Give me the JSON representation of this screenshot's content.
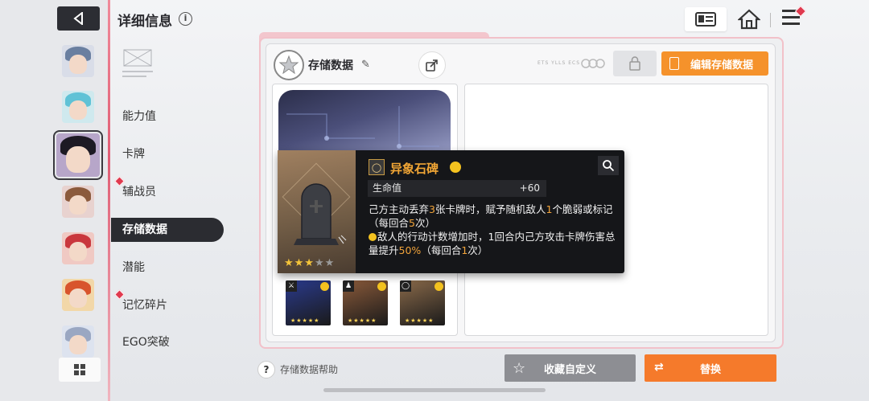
{
  "header": {
    "title": "详细信息",
    "info_glyph": "i"
  },
  "sidebar": {
    "avatars": [
      {
        "name": "avatar-1",
        "hair": "#6a7fa0",
        "bg": "#d9dde8"
      },
      {
        "name": "avatar-2",
        "hair": "#5fc2d6",
        "bg": "#cfe9ee"
      },
      {
        "name": "avatar-3",
        "hair": "#1d1a24",
        "bg": "#b7a6c9"
      },
      {
        "name": "avatar-4",
        "hair": "#8b5a3c",
        "bg": "#e8d2cf"
      },
      {
        "name": "avatar-5",
        "hair": "#c9373d",
        "bg": "#f0c9c3"
      },
      {
        "name": "avatar-6",
        "hair": "#d8542c",
        "bg": "#f2d7a8"
      },
      {
        "name": "avatar-7",
        "hair": "#9aa7c2",
        "bg": "#dde3ef"
      }
    ]
  },
  "nav": {
    "items": [
      {
        "label": "能力值",
        "badge": false
      },
      {
        "label": "卡牌",
        "badge": false
      },
      {
        "label": "辅战员",
        "badge": true
      },
      {
        "label": "存储数据",
        "badge": false,
        "active": true
      },
      {
        "label": "潜能",
        "badge": false
      },
      {
        "label": "记忆碎片",
        "badge": true
      },
      {
        "label": "EGO突破",
        "badge": false
      }
    ]
  },
  "panel": {
    "title": "存储数据",
    "edit_label": "编辑存储数据",
    "tiny_text": "ETS YLLS ECS"
  },
  "tooltip": {
    "name": "异象石碑",
    "stat_label": "生命值",
    "stat_value": "+60",
    "desc1_a": "己方主动丢弃",
    "desc1_n1": "3",
    "desc1_b": "张卡牌时，赋予随机敌人",
    "desc1_n2": "1",
    "desc1_c": "个脆弱或标记（每回合",
    "desc1_n3": "5",
    "desc1_d": "次）",
    "desc2_a": "敌人的行动计数增加时，1回合内己方攻击卡牌伤害总量提升",
    "desc2_n1": "50%",
    "desc2_b": "（每回合",
    "desc2_n2": "1",
    "desc2_c": "次）",
    "stars_on": "★★★",
    "stars_off": "★★"
  },
  "relics": [
    {
      "icon": "sword-icon",
      "glyph": "⚔",
      "bg": "#2a3a8c",
      "stars": "★★★★★"
    },
    {
      "icon": "armor-icon",
      "glyph": "♟",
      "bg": "#8a5a3a",
      "stars": "★★★★★"
    },
    {
      "icon": "ring-icon",
      "glyph": "◯",
      "bg": "#8a6a4a",
      "stars": "★★★★★"
    }
  ],
  "footer": {
    "help_glyph": "?",
    "help_label": "存储数据帮助",
    "fav_label": "收藏自定义",
    "replace_label": "替换"
  },
  "colors": {
    "accent_orange": "#f5922b",
    "replace_orange": "#f57a2b",
    "highlight": "#f1a33a",
    "alert_red": "#e03a4f"
  }
}
